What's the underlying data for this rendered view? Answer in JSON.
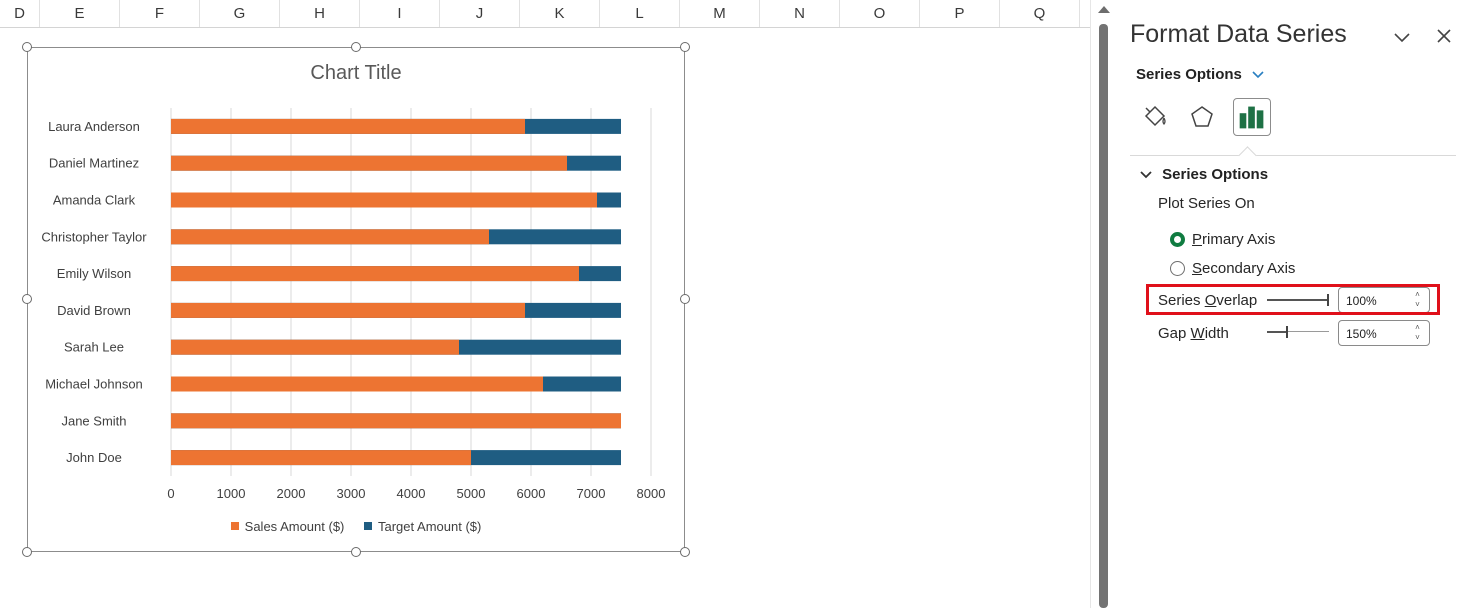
{
  "sheet": {
    "columns": [
      "D",
      "E",
      "F",
      "G",
      "H",
      "I",
      "J",
      "K",
      "L",
      "M",
      "N",
      "O",
      "P",
      "Q"
    ]
  },
  "chart": {
    "title": "Chart Title",
    "legend": [
      {
        "label": "Sales Amount ($)",
        "color": "#ed7432"
      },
      {
        "label": "Target Amount ($)",
        "color": "#1f5d82"
      }
    ]
  },
  "chart_data": {
    "type": "bar",
    "orientation": "horizontal",
    "stacked": false,
    "series_overlap_percent": 100,
    "title": "Chart Title",
    "categories": [
      "Laura Anderson",
      "Daniel Martinez",
      "Amanda Clark",
      "Christopher Taylor",
      "Emily Wilson",
      "David Brown",
      "Sarah Lee",
      "Michael Johnson",
      "Jane Smith",
      "John Doe"
    ],
    "series": [
      {
        "name": "Target Amount ($)",
        "color": "#1f5d82",
        "values": [
          7500,
          7500,
          7500,
          7500,
          7500,
          7500,
          7500,
          7500,
          7500,
          7500
        ]
      },
      {
        "name": "Sales Amount ($)",
        "color": "#ed7432",
        "values": [
          5900,
          6600,
          7100,
          5300,
          6800,
          5900,
          4800,
          6200,
          7500,
          5000
        ]
      }
    ],
    "xlim": [
      0,
      8000
    ],
    "xticks": [
      0,
      1000,
      2000,
      3000,
      4000,
      5000,
      6000,
      7000,
      8000
    ],
    "grid": true,
    "legend_position": "bottom"
  },
  "pane": {
    "title": "Format Data Series",
    "options_dropdown": "Series Options",
    "section": "Series Options",
    "plot_series_on": "Plot Series On",
    "primary_axis": {
      "pre": "",
      "ul": "P",
      "post": "rimary Axis"
    },
    "secondary_axis": {
      "pre": "",
      "ul": "S",
      "post": "econdary Axis"
    },
    "series_overlap": {
      "pre": "Series ",
      "ul": "O",
      "post": "verlap",
      "value": "100%",
      "level": 1.0
    },
    "gap_width": {
      "pre": "Gap ",
      "ul": "W",
      "post": "idth",
      "value": "150%",
      "level": 0.3
    },
    "selected_axis": "Primary Axis"
  }
}
